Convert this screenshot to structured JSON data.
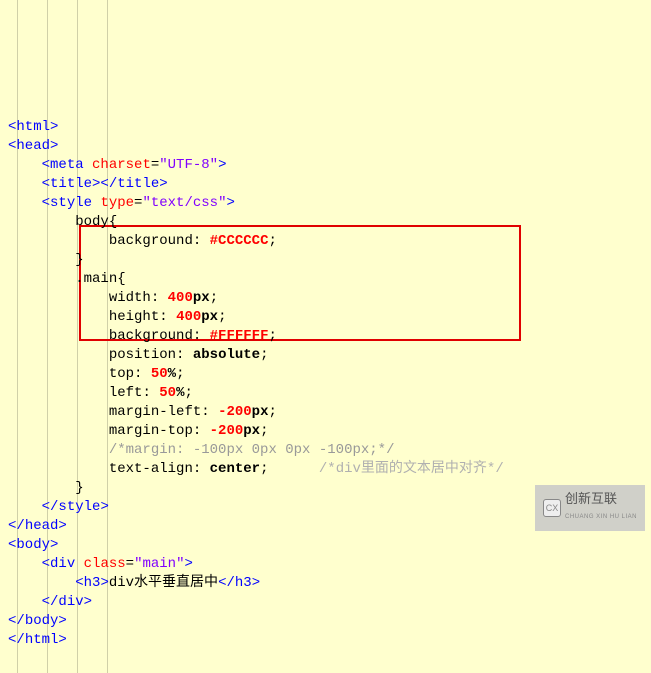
{
  "code": {
    "html_tag": "html",
    "head_tag": "head",
    "meta_tag": "meta",
    "charset_attr": "charset",
    "charset_val": "\"UTF-8\"",
    "title_tag": "title",
    "style_tag": "style",
    "type_attr": "type",
    "type_val": "\"text/css\"",
    "body_sel": "body",
    "bg_prop": "background",
    "bg_val1": "#CCCCCC",
    "main_sel": ".main",
    "width_prop": "width",
    "width_val": "400",
    "height_prop": "height",
    "height_val": "400",
    "bg_val2": "#FFFFFF",
    "position_prop": "position",
    "position_val": "absolute",
    "top_prop": "top",
    "top_val": "50",
    "left_prop": "left",
    "left_val": "50",
    "ml_prop": "margin-left",
    "ml_val": "-200",
    "mt_prop": "margin-top",
    "mt_val": "-200",
    "comment1": "/*margin: -100px 0px 0px -100px;*/",
    "ta_prop": "text-align",
    "ta_val": "center",
    "comment2": "/*div里面的文本居中对齐*/",
    "px": "px",
    "pct": "%",
    "body_tag": "body",
    "div_tag": "div",
    "class_attr": "class",
    "class_val": "\"main\"",
    "h3_tag": "h3",
    "h3_text": "div水平垂直居中"
  },
  "watermark": {
    "text": "创新互联",
    "sub": "CHUANG XIN HU LIAN"
  }
}
